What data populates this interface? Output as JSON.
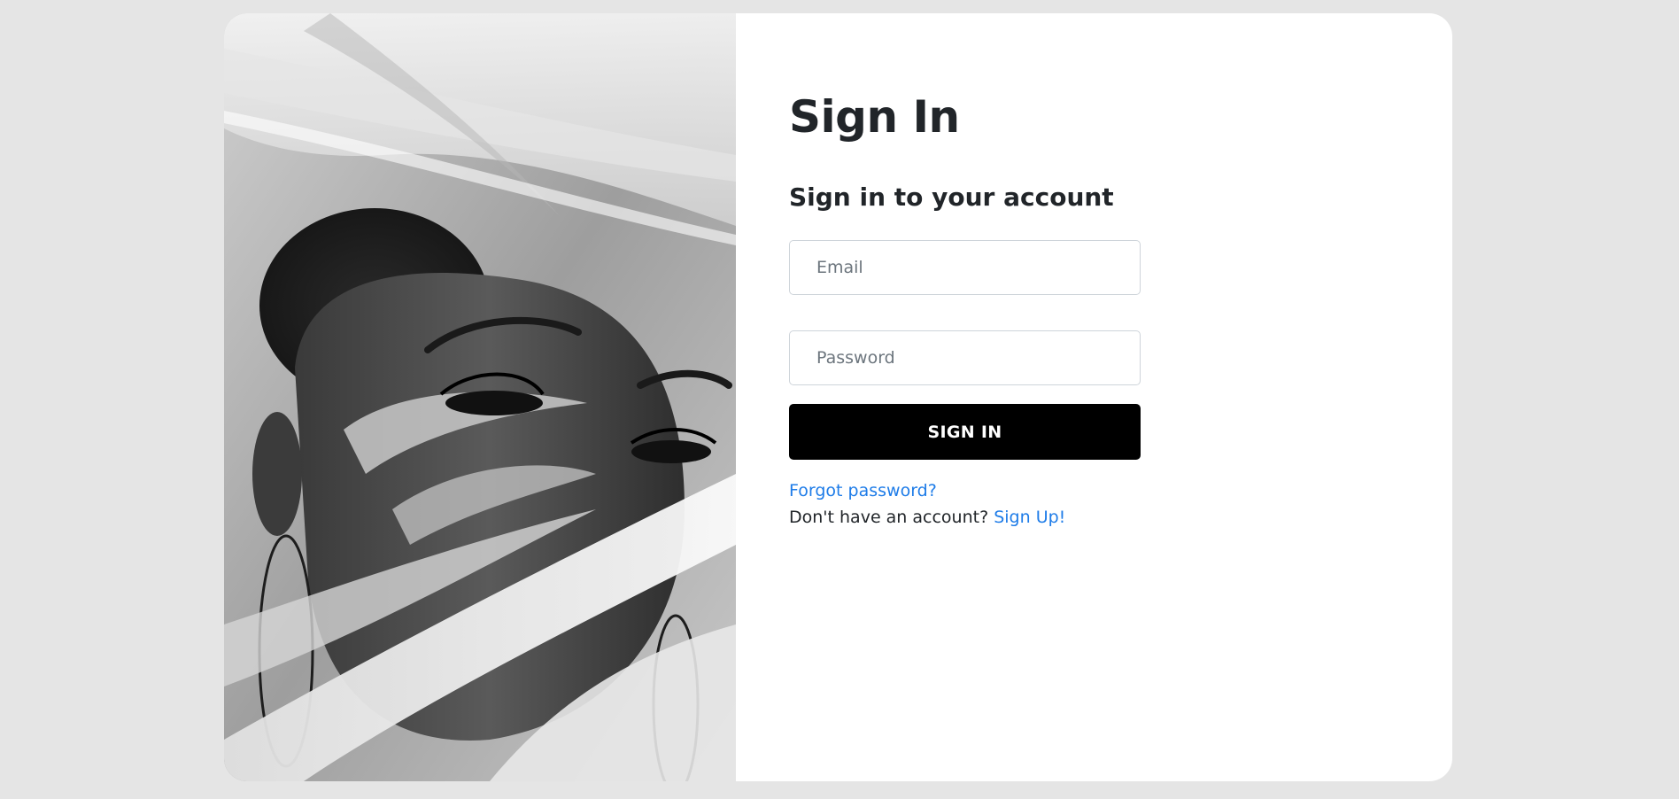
{
  "signin": {
    "title": "Sign In",
    "subtitle": "Sign in to your account",
    "email_placeholder": "Email",
    "email_value": "",
    "password_placeholder": "Password",
    "password_value": "",
    "submit_label": "SIGN IN",
    "forgot_label": "Forgot password?",
    "no_account_text": "Don't have an account?",
    "signup_label": "Sign Up!"
  },
  "colors": {
    "page_bg": "#e5e5e5",
    "card_bg": "#ffffff",
    "button_bg": "#000000",
    "link": "#1e7ce8",
    "text": "#212529"
  },
  "photo": {
    "icon": "portrait-photo",
    "style": "grayscale"
  }
}
